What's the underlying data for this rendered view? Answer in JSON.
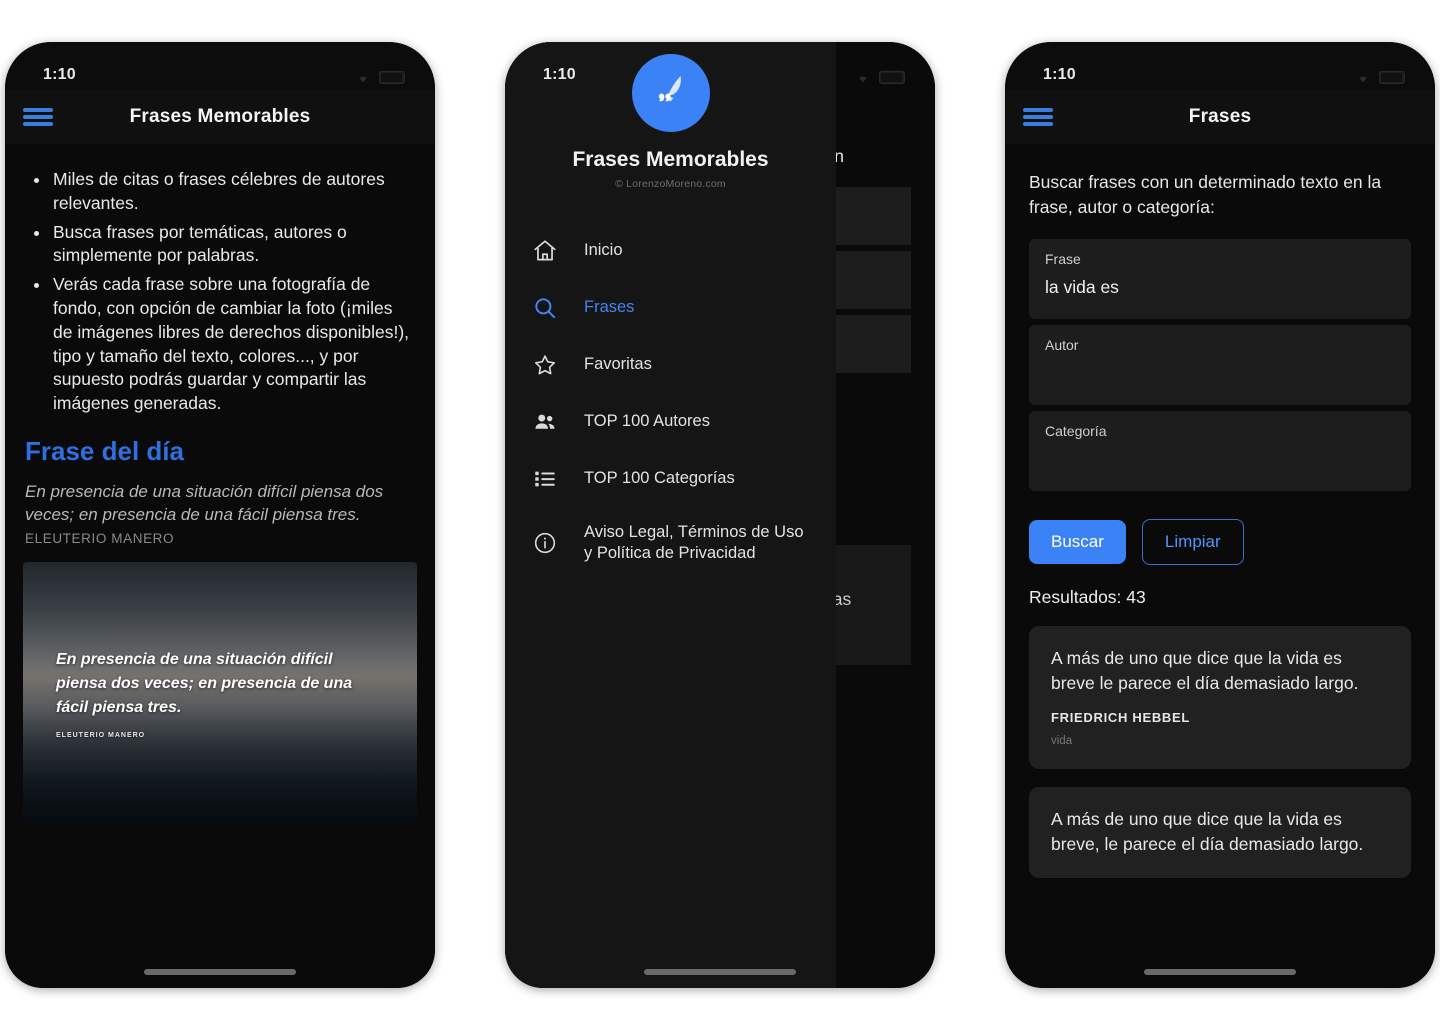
{
  "app": {
    "name": "Frases Memorables",
    "copyright": "© LorenzoMoreno.com",
    "accent": "#3b82f6",
    "accent_dim": "#4285f4",
    "screen_bg": "#0a0a0a",
    "card_bg": "#212121"
  },
  "status_bar": {
    "time": "1:10",
    "wifi_icon": "wifi-icon",
    "battery_icon": "battery-icon"
  },
  "screen1": {
    "appbar": {
      "menu_icon": "hamburger-menu-icon",
      "title": "Frases Memorables"
    },
    "features": [
      "Miles de citas o frases célebres de autores relevantes.",
      "Busca frases por temáticas, autores o simplemente por palabras.",
      "Verás cada frase sobre una fotografía de fondo, con opción de cambiar la foto (¡miles de imágenes libres de derechos disponibles!), tipo y tamaño del texto, colores..., y por supuesto podrás guardar y compartir las imágenes generadas."
    ],
    "quote_of_day": {
      "heading": "Frase del día",
      "text": "En presencia de una situación difícil piensa dos veces; en presencia de una fácil piensa tres.",
      "author": "ELEUTERIO MANERO"
    },
    "quote_card": {
      "text": "En presencia de una situación difícil piensa dos veces; en presencia de una fácil piensa tres.",
      "author": "ELEUTERIO MANERO"
    }
  },
  "screen2": {
    "drawer": {
      "logo_icon": "quill-quote-logo-icon",
      "title": "Frases Memorables",
      "subtitle": "© LorenzoMoreno.com",
      "items": [
        {
          "label": "Inicio",
          "icon": "home-icon",
          "active": false
        },
        {
          "label": "Frases",
          "icon": "search-icon",
          "active": true
        },
        {
          "label": "Favoritas",
          "icon": "star-icon",
          "active": false
        },
        {
          "label": "TOP 100 Autores",
          "icon": "people-icon",
          "active": false
        },
        {
          "label": "TOP 100 Categorías",
          "icon": "list-icon",
          "active": false
        },
        {
          "label": "Aviso Legal, Términos de Uso y Política de Privacidad",
          "icon": "info-icon",
          "active": false
        }
      ]
    },
    "background_screen": {
      "help_fragment": "to en",
      "card_fragment": "ñas"
    }
  },
  "screen3": {
    "appbar": {
      "menu_icon": "hamburger-menu-icon",
      "title": "Frases"
    },
    "search_help": "Buscar frases con un determinado texto en la frase, autor o categoría:",
    "fields": [
      {
        "label": "Frase",
        "value": "la vida es",
        "placeholder": ""
      },
      {
        "label": "Autor",
        "value": "",
        "placeholder": ""
      },
      {
        "label": "Categoría",
        "value": "",
        "placeholder": ""
      }
    ],
    "buttons": {
      "search": "Buscar",
      "clear": "Limpiar"
    },
    "results_label": "Resultados: 43",
    "results": [
      {
        "text": "A más de uno que dice que la vida es breve le parece el día demasiado largo.",
        "author": "FRIEDRICH HEBBEL",
        "category": "vida"
      },
      {
        "text": "A más de uno que dice que la vida es breve, le parece el día demasiado largo.",
        "author": "",
        "category": ""
      }
    ]
  }
}
